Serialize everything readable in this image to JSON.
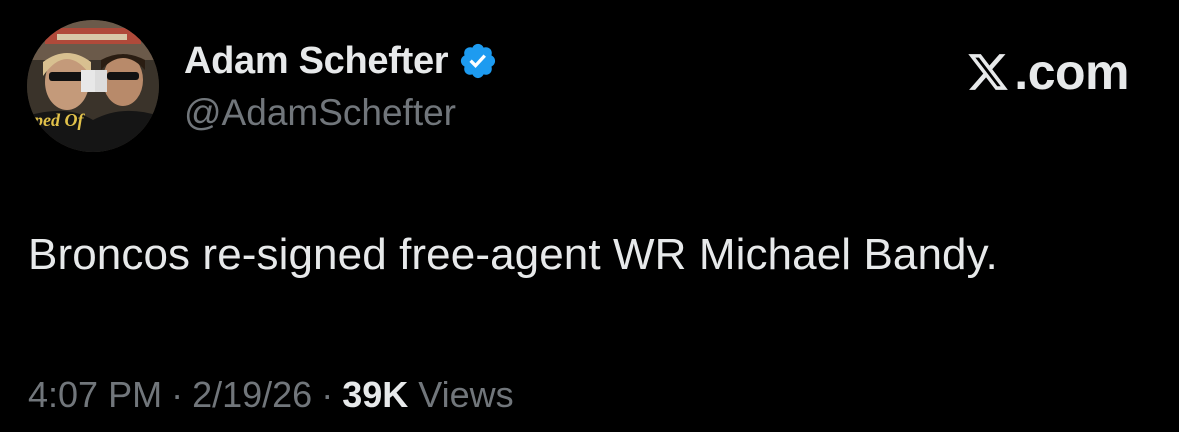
{
  "author": {
    "display_name": "Adam Schefter",
    "handle": "@AdamSchefter",
    "avatar_caption": "pped Of",
    "verified_badge_icon": "verified-badge-icon",
    "verified_color": "#1d9bf0"
  },
  "brand": {
    "icon": "x-logo-icon",
    "text": ".com"
  },
  "tweet": {
    "text": "Broncos re-signed free-agent WR Michael Bandy."
  },
  "meta": {
    "time": "4:07 PM",
    "separator": "·",
    "date": "2/19/26",
    "views_count": "39K",
    "views_label": "Views"
  },
  "colors": {
    "background": "#000000",
    "primary_text": "#e7e9ea",
    "secondary_text": "#71767b"
  }
}
